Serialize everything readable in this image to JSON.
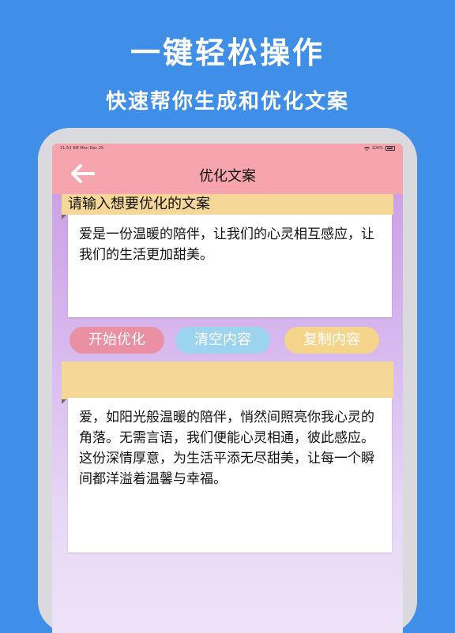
{
  "promo": {
    "headline": "一键轻松操作",
    "subline": "快速帮你生成和优化文案"
  },
  "status_bar": {
    "time": "11:53 AM",
    "date": "Mon Dec 25",
    "battery": "100%"
  },
  "nav": {
    "back_icon": "arrow-left-icon",
    "title": "优化文案"
  },
  "input": {
    "label": "请输入想要优化的文案",
    "value": "爱是一份温暖的陪伴，让我们的心灵相互感应，让我们的生活更加甜美。"
  },
  "buttons": {
    "start": "开始优化",
    "clear": "清空内容",
    "copy": "复制内容"
  },
  "output": {
    "value": "爱，如阳光般温暖的陪伴，悄然间照亮你我心灵的角落。无需言语，我们便能心灵相通，彼此感应。这份深情厚意，为生活平添无尽甜美，让每一个瞬间都洋溢着温馨与幸福。"
  },
  "colors": {
    "background": "#3f8ee8",
    "nav_bar": "#f6a4ad",
    "label_bar": "#f5d897",
    "start_button": "#eb8fa3",
    "clear_button": "#9cd3ee",
    "copy_button": "#f5d48c"
  }
}
